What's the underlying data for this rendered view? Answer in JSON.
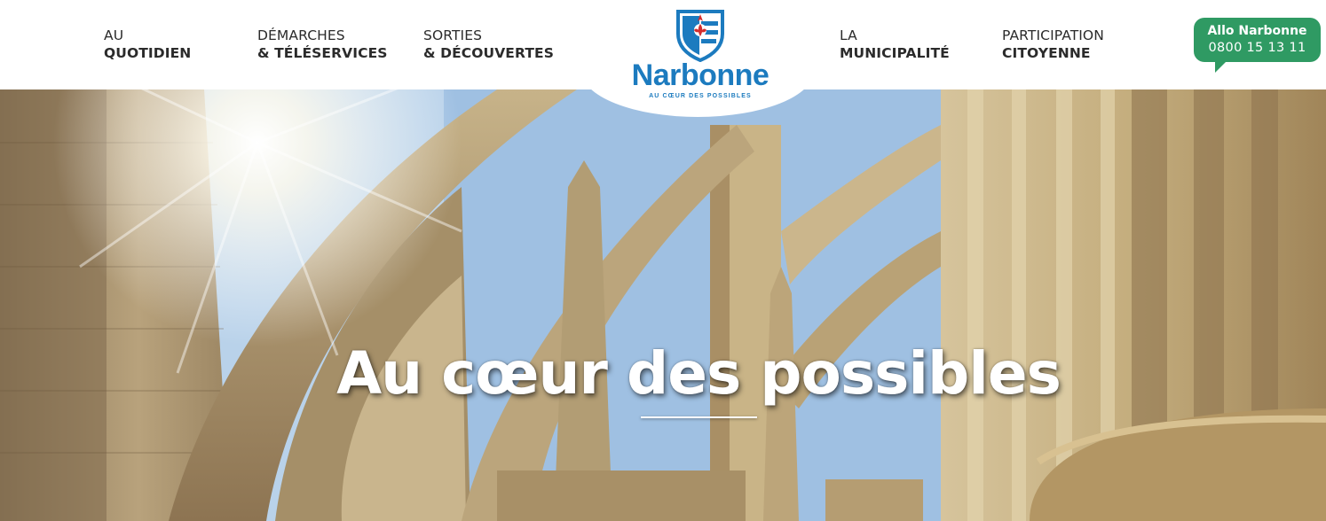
{
  "header": {
    "nav": [
      {
        "line1": "AU",
        "line2": "QUOTIDIEN"
      },
      {
        "line1": "DÉMARCHES",
        "line2": "& TÉLÉSERVICES"
      },
      {
        "line1": "SORTIES",
        "line2": "& DÉCOUVERTES"
      },
      {
        "line1": "LA",
        "line2": "MUNICIPALITÉ"
      },
      {
        "line1": "PARTICIPATION",
        "line2": "CITOYENNE"
      }
    ],
    "logo": {
      "name": "Narbonne",
      "tagline": "AU CŒUR DES POSSIBLES"
    },
    "allo": {
      "title": "Allo Narbonne",
      "phone": "0800 15 13 11"
    }
  },
  "hero": {
    "title": "Au cœur des possibles"
  },
  "colors": {
    "brand_blue": "#1c7bbf",
    "allo_green": "#2f9a63",
    "stone": "#c9b48a"
  },
  "icons": [
    "shield-icon"
  ]
}
